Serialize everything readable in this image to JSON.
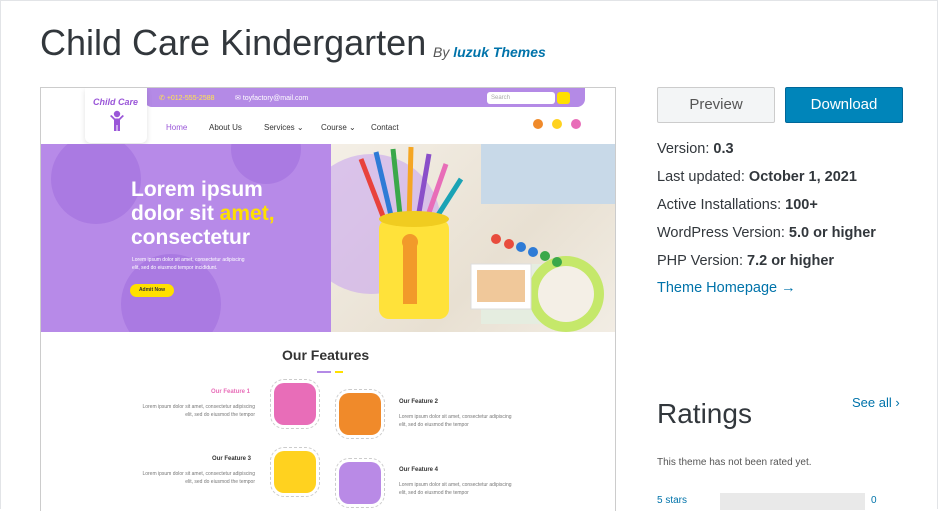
{
  "theme": {
    "title": "Child Care Kindergarten",
    "by_label": "By",
    "author": "luzuk Themes"
  },
  "preview_site": {
    "logo_text": "Child Care",
    "phone": "+012-555-2588",
    "email": "toyfactory@mail.com",
    "search_placeholder": "Search",
    "nav": [
      "Home",
      "About Us",
      "Services",
      "Course",
      "Contact"
    ],
    "hero_line1": "Lorem ipsum",
    "hero_line2a": "dolor sit ",
    "hero_line2b": "amet,",
    "hero_line3": "consectetur",
    "hero_p1": "Lorem ipsum dolor sit amet, consectetur adipiscing",
    "hero_p2": "elit, sed do eiusmod tempor incididunt.",
    "hero_button": "Admit Now",
    "features_title": "Our Features",
    "features": [
      {
        "label": "Our  Feature 1",
        "text1": "Lorem ipsum dolor sit amet, consectetur adipiscing",
        "text2": "elit, sed do eiusmod the tempor",
        "color": "#e86db8"
      },
      {
        "label": "Our Feature 2",
        "text1": "Lorem ipsum dolor sit amet, consectetur adipiscing",
        "text2": "elit, sed do eiusmod the tempor",
        "color": "#f08a2a"
      },
      {
        "label": "Our Feature 3",
        "text1": "Lorem ipsum dolor sit amet, consectetur adipiscing",
        "text2": "elit, sed do eiusmod the tempor",
        "color": "#ffd21f"
      },
      {
        "label": "Our Feature 4",
        "text1": "Lorem ipsum dolor sit amet, consectetur adipiscing",
        "text2": "elit, sed do eiusmod the tempor",
        "color": "#b98ae6"
      }
    ]
  },
  "actions": {
    "preview": "Preview",
    "download": "Download"
  },
  "meta": {
    "version_label": "Version: ",
    "version": "0.3",
    "updated_label": "Last updated: ",
    "updated": "October 1, 2021",
    "installs_label": "Active Installations: ",
    "installs": "100+",
    "wp_label": "WordPress Version: ",
    "wp": "5.0 or higher",
    "php_label": "PHP Version: ",
    "php": "7.2 or higher",
    "homepage": "Theme Homepage →"
  },
  "ratings": {
    "heading": "Ratings",
    "see_all": "See all",
    "empty_text": "This theme has not been rated yet.",
    "rows": [
      {
        "label": "5 stars",
        "count": "0",
        "fraction": 0
      }
    ]
  },
  "colors": {
    "accent_blue": "#0085ba",
    "link": "#0073aa",
    "hero_purple": "#b78ae8",
    "accent_yellow": "#ffe000"
  }
}
